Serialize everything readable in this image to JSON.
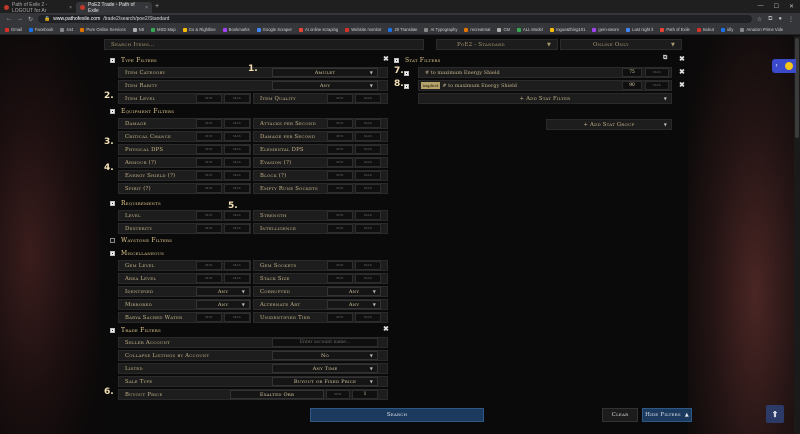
{
  "browser": {
    "tabs": [
      {
        "label": "Path of Exile 2 - LOGOUT for Ar"
      },
      {
        "label": "PoE2 Trade - Path of Exile"
      }
    ],
    "url_domain": "www.pathofexile.com",
    "url_path": "/trade2/search/poe2/Standard",
    "bookmarks": [
      "Gmail",
      "Facebook",
      "444",
      "Pure Online Services",
      "N8",
      "MSD Map",
      "Go & Rightline",
      "Bookmarks",
      "Google Scraper",
      "AI online scraping",
      "Website monitor",
      "20 Translate",
      "AI Typography",
      "recreatmat",
      "CM",
      "ALL Model",
      "rogue&thing101",
      "gem-sworn",
      "Last night li",
      "Path of Exile",
      "tsukut",
      "idly",
      "Amazon Prime Vide"
    ]
  },
  "search": {
    "search_items_label": "Search Items...",
    "league": "PoE2 - Standard",
    "status": "Online Only"
  },
  "type_filters": {
    "title": "Type Filters",
    "item_category_label": "Item Category",
    "item_category_value": "Amulet",
    "item_rarity_label": "Item Rarity",
    "item_rarity_value": "Any",
    "item_level_label": "Item Level",
    "item_quality_label": "Item Quality"
  },
  "placeholders": {
    "min": "min",
    "max": "max",
    "account": "Enter account name..."
  },
  "equipment_filters": {
    "title": "Equipment Filters",
    "left": [
      "Damage",
      "Critical Chance",
      "Physical DPS",
      "Armour (?)",
      "Energy Shield (?)",
      "Spirit (?)"
    ],
    "right": [
      "Attacks per Second",
      "Damage per Second",
      "Elemental DPS",
      "Evasion (?)",
      "Block (?)",
      "Empty Rune Sockets"
    ]
  },
  "requirements": {
    "title": "Requirements",
    "left": [
      "Level",
      "Dexterity"
    ],
    "right": [
      "Strength",
      "Intelligence"
    ]
  },
  "waystone_filters": {
    "title": "Waystone Filters"
  },
  "miscellaneous": {
    "title": "Miscellaneous",
    "gem_level": "Gem Level",
    "gem_sockets": "Gem Sockets",
    "area_level": "Area Level",
    "stack_size": "Stack Size",
    "identified": "Identified",
    "identified_value": "Any",
    "corrupted": "Corrupted",
    "corrupted_value": "Any",
    "mirrored": "Mirrored",
    "mirrored_value": "Any",
    "alternate_art": "Alternate Art",
    "alternate_art_value": "Any",
    "barya": "Barya Sacred Water",
    "unidentified_tier": "Unidentified Tier"
  },
  "trade_filters": {
    "title": "Trade Filters",
    "seller_account": "Seller Account",
    "collapse_label": "Collapse Listings by Account",
    "collapse_value": "No",
    "listed_label": "Listed",
    "listed_value": "Any Time",
    "sale_type_label": "Sale Type",
    "sale_type_value": "Buyout or Fixed Price",
    "buyout_label": "Buyout Price",
    "buyout_currency": "Exalted Orb",
    "buyout_max": "1"
  },
  "stat_filters": {
    "title": "Stat Filters",
    "stats": [
      {
        "text": "# to maximum Energy Shield",
        "tag": "",
        "min": "75",
        "max": "max"
      },
      {
        "text": "# to maximum Energy Shield",
        "tag": "implicit",
        "min": "90",
        "max": "max"
      }
    ],
    "add_stat_filter": "+ Add Stat Filter",
    "add_stat_group": "+ Add Stat Group"
  },
  "buttons": {
    "search": "Search",
    "clear": "Clear",
    "hide_filters": "Hide Filters"
  },
  "annotations": [
    "1.",
    "2.",
    "3.",
    "4.",
    "5.",
    "6.",
    "7.",
    "8."
  ]
}
